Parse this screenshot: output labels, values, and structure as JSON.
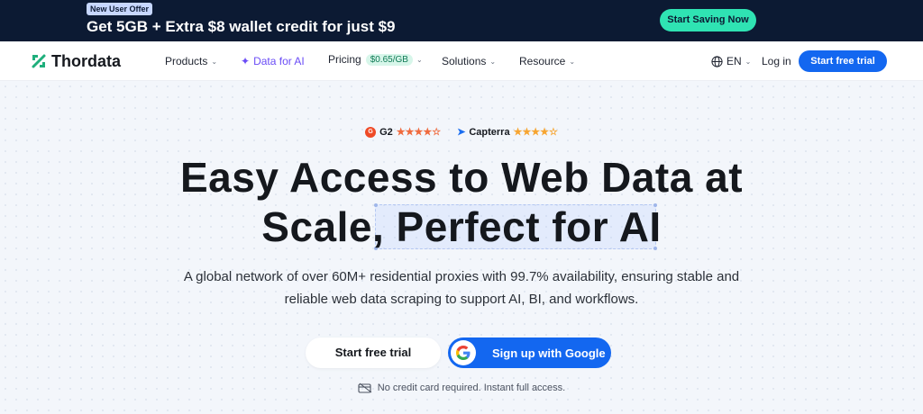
{
  "promo": {
    "badge": "New User Offer",
    "text": "Get 5GB + Extra $8 wallet credit for just $9",
    "cta": "Start Saving Now"
  },
  "nav": {
    "logo": "Thordata",
    "items": [
      {
        "label": "Products"
      },
      {
        "label": "Data for AI"
      },
      {
        "label": "Pricing",
        "badge": "$0.65/GB"
      },
      {
        "label": "Solutions"
      },
      {
        "label": "Resource"
      }
    ],
    "language": "EN",
    "login": "Log in",
    "trial": "Start free trial"
  },
  "hero": {
    "ratings": [
      {
        "name": "G2",
        "stars": "★★★★☆"
      },
      {
        "name": "Capterra",
        "stars": "★★★★☆"
      }
    ],
    "headline_line1": "Easy Access to Web Data at",
    "headline_line2": "Scale, Perfect for AI",
    "subtitle_line1": "A global network of over 60M+ residential proxies with 99.7% availability, ensuring stable and",
    "subtitle_line2": "reliable web data scraping to support AI, BI, and workflows.",
    "cta_trial": "Start free trial",
    "cta_google": "Sign up with Google",
    "note": "No credit card required. Instant full access."
  },
  "colors": {
    "promo_bg": "#0c1a33",
    "accent_green": "#2fe3b3",
    "primary_blue": "#1367f0",
    "ai_purple": "#6a4cf6"
  }
}
